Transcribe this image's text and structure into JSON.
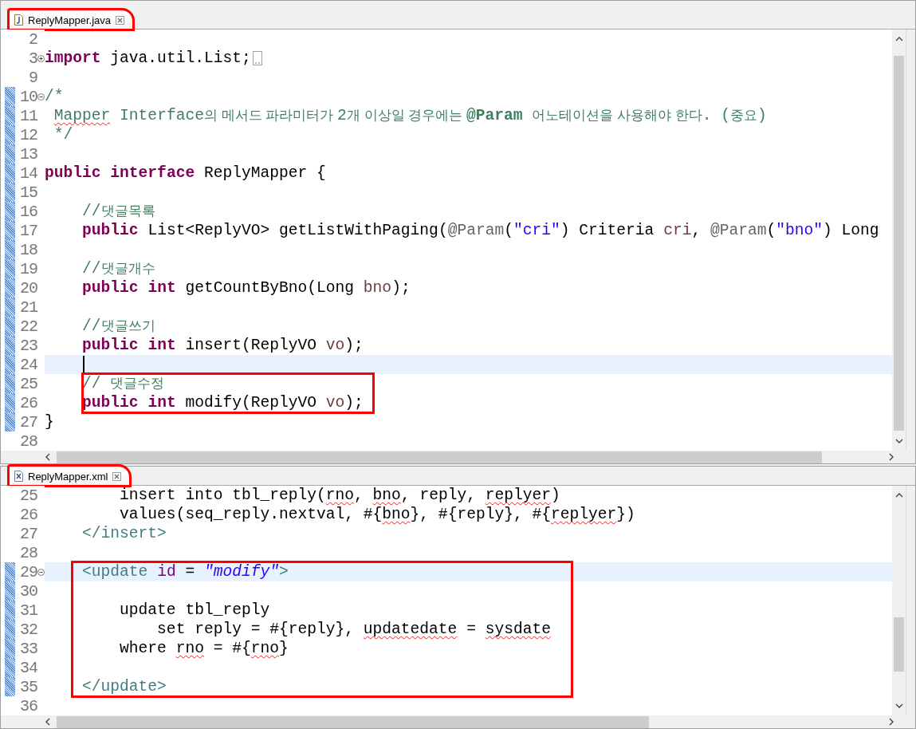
{
  "panes": [
    {
      "tab": {
        "label": "ReplyMapper.java",
        "kind": "java",
        "selected": true,
        "framed": true
      },
      "lines": [
        {
          "kind": "line",
          "number": "2"
        },
        {
          "kind": "line",
          "number": "3",
          "folded": true,
          "tokens": [
            {
              "kind": "kw",
              "t": "import"
            },
            {
              "kind": "plain",
              "t": " java.util.List;"
            }
          ]
        },
        {
          "kind": "line",
          "number": "9"
        },
        {
          "kind": "line",
          "number": "10",
          "folded": false,
          "changed": true,
          "tokens": [
            {
              "kind": "comment",
              "t": "/*"
            }
          ]
        },
        {
          "kind": "line",
          "number": "11",
          "changed": true,
          "tokens": [
            {
              "kind": "comment",
              "t": " Mapper",
              "spell": true
            },
            {
              "kind": "comment",
              "t": " Interface"
            },
            {
              "kind": "hangul",
              "t": "의 메서드 파라미터가 "
            },
            {
              "kind": "comment",
              "t": "2"
            },
            {
              "kind": "hangul",
              "t": "개 이상일 경우에는 "
            },
            {
              "kind": "comment",
              "t": "**@Param**"
            },
            {
              "kind": "hangul",
              "t": " 어노테이션을 사용해야 한다"
            },
            {
              "kind": "comment",
              "t": ". ("
            },
            {
              "kind": "hangul",
              "t": "중요"
            },
            {
              "kind": "comment",
              "t": ")"
            }
          ]
        },
        {
          "kind": "line",
          "number": "12",
          "changed": true,
          "tokens": [
            {
              "kind": "comment",
              "t": " */"
            }
          ]
        },
        {
          "kind": "line",
          "number": "13",
          "changed": true
        },
        {
          "kind": "line",
          "number": "14",
          "changed": true,
          "tokens": [
            {
              "kind": "kw",
              "t": "public"
            },
            {
              "kind": "kw",
              "t": " interface"
            },
            {
              "kind": "plain",
              "t": " ReplyMapper {"
            }
          ]
        },
        {
          "kind": "line",
          "number": "15",
          "changed": true
        },
        {
          "kind": "line",
          "number": "16",
          "changed": true,
          "tokens": [
            {
              "kind": "comment",
              "t": "    //"
            },
            {
              "kind": "hangul",
              "t": "댓글목록"
            }
          ]
        },
        {
          "kind": "line",
          "number": "17",
          "changed": true,
          "tokens": [
            {
              "kind": "kw",
              "t": "    public"
            },
            {
              "kind": "plain",
              "t": " List<ReplyVO> getListWithPaging("
            },
            {
              "kind": "ann",
              "t": "@Param"
            },
            {
              "kind": "plain",
              "t": "("
            },
            {
              "kind": "str",
              "t": "\"cri\""
            },
            {
              "kind": "plain",
              "t": ") Criteria"
            },
            {
              "kind": "var",
              "t": " cri"
            },
            {
              "kind": "plain",
              "t": ","
            },
            {
              "kind": "ann",
              "t": " @Param"
            },
            {
              "kind": "plain",
              "t": "("
            },
            {
              "kind": "str",
              "t": "\"bno\""
            },
            {
              "kind": "plain",
              "t": ") Long"
            }
          ]
        },
        {
          "kind": "line",
          "number": "18",
          "changed": true
        },
        {
          "kind": "line",
          "number": "19",
          "changed": true,
          "tokens": [
            {
              "kind": "comment",
              "t": "    //"
            },
            {
              "kind": "hangul",
              "t": "댓글개수"
            }
          ]
        },
        {
          "kind": "line",
          "number": "20",
          "changed": true,
          "tokens": [
            {
              "kind": "kw",
              "t": "    public"
            },
            {
              "kind": "kw",
              "t": " int"
            },
            {
              "kind": "plain",
              "t": " getCountByBno(Long"
            },
            {
              "kind": "var",
              "t": " bno"
            },
            {
              "kind": "plain",
              "t": ");"
            }
          ]
        },
        {
          "kind": "line",
          "number": "21",
          "changed": true
        },
        {
          "kind": "line",
          "number": "22",
          "changed": true,
          "tokens": [
            {
              "kind": "comment",
              "t": "    //"
            },
            {
              "kind": "hangul",
              "t": "댓글쓰기"
            }
          ]
        },
        {
          "kind": "line",
          "number": "23",
          "changed": true,
          "tokens": [
            {
              "kind": "kw",
              "t": "    public"
            },
            {
              "kind": "kw",
              "t": " int"
            },
            {
              "kind": "plain",
              "t": " insert(ReplyVO"
            },
            {
              "kind": "var",
              "t": " vo"
            },
            {
              "kind": "plain",
              "t": ");"
            }
          ]
        },
        {
          "kind": "line",
          "number": "24",
          "changed": true,
          "current": true,
          "cursor": true
        },
        {
          "kind": "frame",
          "lines": [
            {
              "kind": "line",
              "number": "25",
              "changed": true,
              "tokens": [
                {
                  "kind": "comment",
                  "t": "    //"
                },
                {
                  "kind": "hangul",
                  "t": " 댓글수정"
                }
              ]
            },
            {
              "kind": "line",
              "number": "26",
              "changed": true,
              "tokens": [
                {
                  "kind": "kw",
                  "t": "    public"
                },
                {
                  "kind": "kw",
                  "t": " int"
                },
                {
                  "kind": "plain",
                  "t": " modify(ReplyVO"
                },
                {
                  "kind": "var",
                  "t": " vo"
                },
                {
                  "kind": "plain",
                  "t": ");"
                }
              ]
            }
          ]
        },
        {
          "kind": "line",
          "number": "27",
          "changed": true,
          "tokens": [
            {
              "kind": "plain",
              "t": "}"
            }
          ]
        },
        {
          "kind": "line",
          "number": "28"
        }
      ]
    },
    {
      "tab": {
        "label": "ReplyMapper.xml",
        "kind": "xml",
        "selected": true,
        "framed": true
      },
      "lines": [
        {
          "kind": "line",
          "number": "25",
          "tokens": [
            {
              "kind": "plain",
              "t": "        insert into tbl_reply("
            },
            {
              "kind": "plain",
              "t": "rno",
              "spell": true
            },
            {
              "kind": "plain",
              "t": ","
            },
            {
              "kind": "plain",
              "t": " bno",
              "spell": true
            },
            {
              "kind": "plain",
              "t": ", reply,"
            },
            {
              "kind": "plain",
              "t": " replyer",
              "spell": true
            },
            {
              "kind": "plain",
              "t": ")"
            }
          ]
        },
        {
          "kind": "line",
          "number": "26",
          "tokens": [
            {
              "kind": "plain",
              "t": "        values(seq_reply.nextval, #{"
            },
            {
              "kind": "plain",
              "t": "bno",
              "spell": true
            },
            {
              "kind": "plain",
              "t": "}, #{reply}, #{"
            },
            {
              "kind": "plain",
              "t": "replyer",
              "spell": true
            },
            {
              "kind": "plain",
              "t": "})"
            }
          ]
        },
        {
          "kind": "line",
          "number": "27",
          "tokens": [
            {
              "kind": "tag",
              "t": "    </insert>"
            }
          ]
        },
        {
          "kind": "line",
          "number": "28"
        },
        {
          "kind": "frame",
          "lines": [
            {
              "kind": "line",
              "number": "29",
              "folded": false,
              "changed": true,
              "current": true,
              "tokens": [
                {
                  "kind": "tag",
                  "t": "    <update"
                },
                {
                  "kind": "attr",
                  "t": " id"
                },
                {
                  "kind": "plain",
                  "t": " ="
                },
                {
                  "kind": "attrval",
                  "t": " \"modify\""
                },
                {
                  "kind": "tag",
                  "t": ">"
                }
              ]
            },
            {
              "kind": "line",
              "number": "30",
              "changed": true
            },
            {
              "kind": "line",
              "number": "31",
              "changed": true,
              "tokens": [
                {
                  "kind": "plain",
                  "t": "        update tbl_reply"
                }
              ]
            },
            {
              "kind": "line",
              "number": "32",
              "changed": true,
              "tokens": [
                {
                  "kind": "plain",
                  "t": "            set reply = #{reply},"
                },
                {
                  "kind": "plain",
                  "t": " updatedate",
                  "spell": true
                },
                {
                  "kind": "plain",
                  "t": " ="
                },
                {
                  "kind": "plain",
                  "t": " sysdate",
                  "spell": true
                }
              ]
            },
            {
              "kind": "line",
              "number": "33",
              "changed": true,
              "tokens": [
                {
                  "kind": "plain",
                  "t": "        where"
                },
                {
                  "kind": "plain",
                  "t": " rno",
                  "spell": true
                },
                {
                  "kind": "plain",
                  "t": " = #{"
                },
                {
                  "kind": "plain",
                  "t": "rno",
                  "spell": true
                },
                {
                  "kind": "plain",
                  "t": "}"
                }
              ]
            },
            {
              "kind": "line",
              "number": "34",
              "changed": true
            },
            {
              "kind": "line",
              "number": "35",
              "changed": true,
              "tokens": [
                {
                  "kind": "tag",
                  "t": "    </update>"
                }
              ]
            }
          ]
        },
        {
          "kind": "line",
          "number": "36"
        }
      ]
    }
  ]
}
